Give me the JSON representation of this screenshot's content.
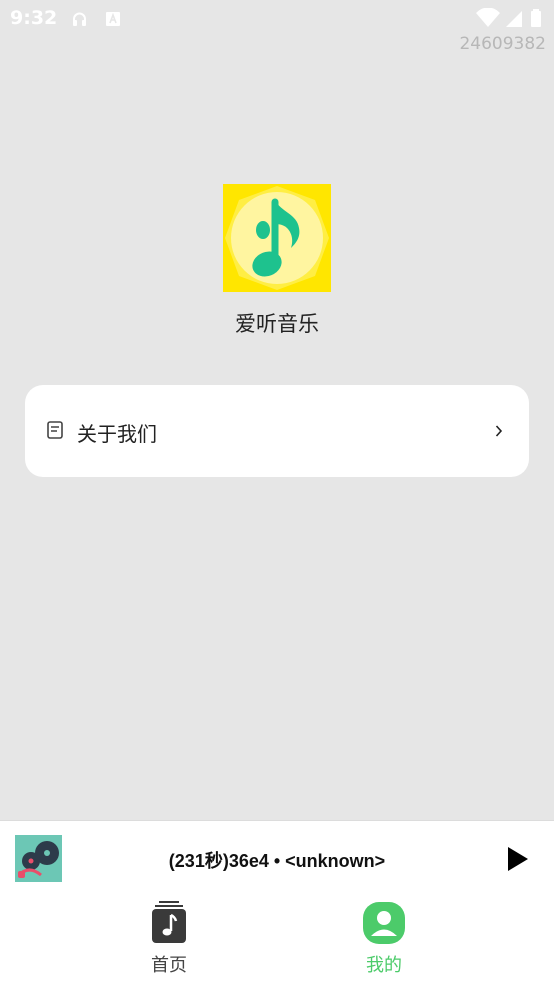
{
  "status_bar": {
    "time": "9:32",
    "icons_left": [
      "headphones-icon",
      "text-a-icon"
    ],
    "icons_right": [
      "wifi-icon",
      "cell-signal-icon",
      "battery-icon"
    ]
  },
  "build_id": "24609382",
  "app": {
    "name": "爱听音乐",
    "logo_icon": "music-note-icon",
    "logo_bg_color": "#ffe600",
    "logo_note_color": "#1ec28e"
  },
  "menu": {
    "items": [
      {
        "label": "关于我们",
        "icon": "document-icon",
        "chevron": "chevron-right-icon"
      }
    ]
  },
  "player": {
    "title": "(231秒)36e4 • <unknown>",
    "play_icon": "play-icon"
  },
  "tabs": [
    {
      "label": "首页",
      "icon": "music-library-icon",
      "active": false
    },
    {
      "label": "我的",
      "icon": "profile-icon",
      "active": true,
      "active_color": "#4ccb6a"
    }
  ]
}
